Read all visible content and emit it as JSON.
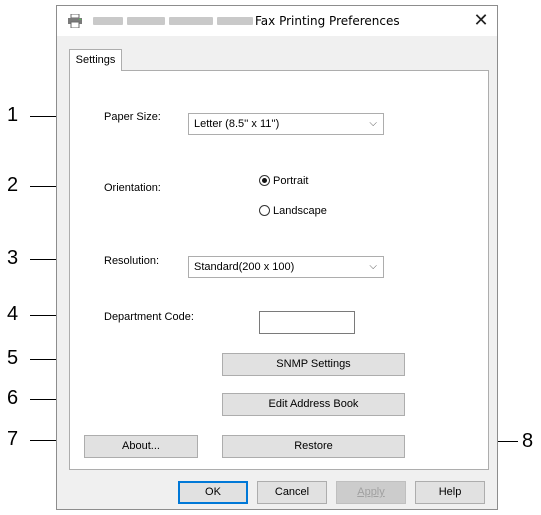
{
  "window": {
    "title": "Fax Printing Preferences",
    "close_glyph": "✕"
  },
  "tabs": [
    {
      "label": "Settings",
      "selected": true
    }
  ],
  "form": {
    "paper_size": {
      "label": "Paper Size:",
      "value": "Letter (8.5'' x 11'')"
    },
    "orientation": {
      "label": "Orientation:",
      "options": [
        {
          "label": "Portrait",
          "selected": true
        },
        {
          "label": "Landscape",
          "selected": false
        }
      ]
    },
    "resolution": {
      "label": "Resolution:",
      "value": "Standard(200 x 100)"
    },
    "department_code": {
      "label": "Department Code:",
      "value": ""
    },
    "snmp_button": "SNMP Settings",
    "address_book_button": "Edit Address Book",
    "about_button": "About...",
    "restore_button": "Restore"
  },
  "footer": {
    "ok": "OK",
    "cancel": "Cancel",
    "apply": "Apply",
    "help": "Help"
  },
  "callouts": [
    "1",
    "2",
    "3",
    "4",
    "5",
    "6",
    "7",
    "8"
  ],
  "colors": {
    "accent": "#0078d7",
    "window_bg": "#f0f0f0"
  },
  "icons": {
    "title": "printer-icon",
    "combo": "chevron-down-icon"
  }
}
